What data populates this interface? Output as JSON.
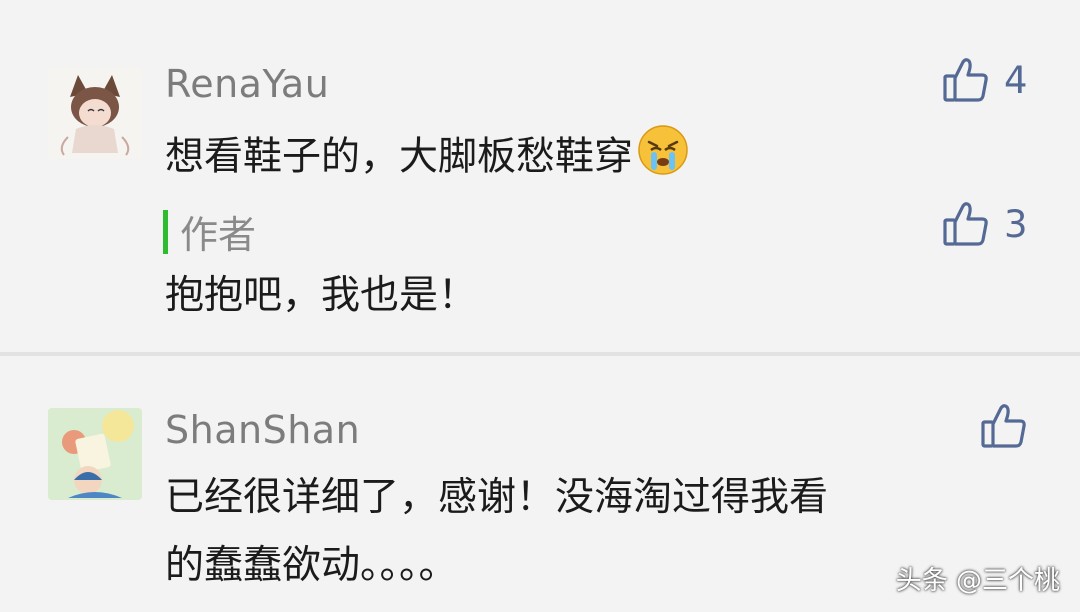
{
  "comments": [
    {
      "username": "RenaYau",
      "text": "想看鞋子的，大脚板愁鞋穿",
      "likes": "4",
      "reply": {
        "author_label": "作者",
        "text": "抱抱吧，我也是！",
        "likes": "3"
      }
    },
    {
      "username": "ShanShan",
      "text_line1": "已经很详细了，感谢！没海淘过得我看",
      "text_line2": "的蠢蠢欲动。。。。"
    }
  ],
  "watermark": "头条 @三个桃",
  "colors": {
    "like_icon": "#546a94",
    "author_bar": "#2dbb2f",
    "username": "#7c7c7c"
  }
}
